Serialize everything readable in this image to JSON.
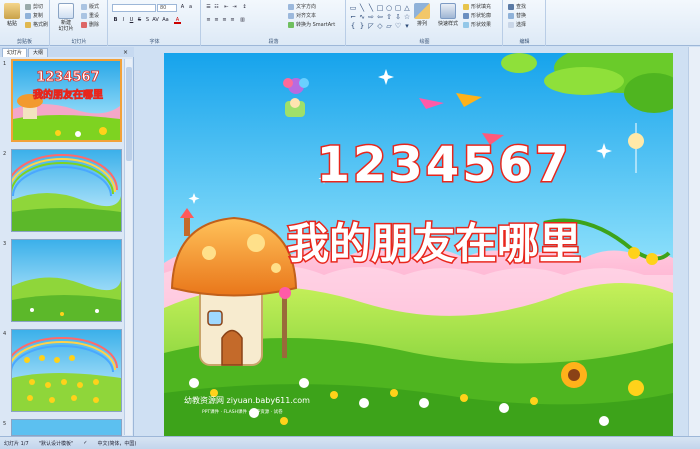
{
  "ribbon": {
    "clipboard": {
      "label": "剪贴板",
      "paste": "粘贴",
      "cut": "剪切",
      "copy": "复制",
      "format_painter": "格式刷"
    },
    "slides": {
      "label": "幻灯片",
      "new_slide": "新建\n幻灯片",
      "layout": "版式",
      "reset": "重设",
      "delete": "删除"
    },
    "font": {
      "label": "字体",
      "font_size": "80"
    },
    "paragraph": {
      "label": "段落",
      "text_direction": "文字方向",
      "align_text": "对齐文本",
      "smartart": "转换为 SmartArt"
    },
    "drawing": {
      "label": "绘图",
      "arrange": "排列",
      "quick_styles": "快速样式",
      "shape_fill": "形状填充",
      "shape_outline": "形状轮廓",
      "shape_effects": "形状效果"
    },
    "editing": {
      "label": "编辑",
      "find": "查找",
      "replace": "替换",
      "select": "选择"
    }
  },
  "panel": {
    "tabs": [
      "幻灯片",
      "大纲"
    ],
    "close": "×",
    "slide_numbers": [
      "1",
      "2",
      "3",
      "4",
      "5"
    ]
  },
  "slide": {
    "number_title": "1234567",
    "main_title": "我的朋友在哪里",
    "watermark_main": "幼教资源网 ziyuan.baby611.com",
    "watermark_sub": "PPT课件 · FLASH课件 · 教养资源 · 试卷"
  },
  "thumb1": {
    "number_title": "1234567",
    "main_title": "我的朋友在哪里"
  },
  "status": {
    "slide_info": "幻灯片 1/7",
    "theme": "\"默认设计模板\"",
    "language": "中文(简体，中国)"
  },
  "colors": {
    "title_red": "#e8261c",
    "sky_top": "#2aa8e8",
    "grass": "#7ed321",
    "selection": "#f2a13a"
  }
}
